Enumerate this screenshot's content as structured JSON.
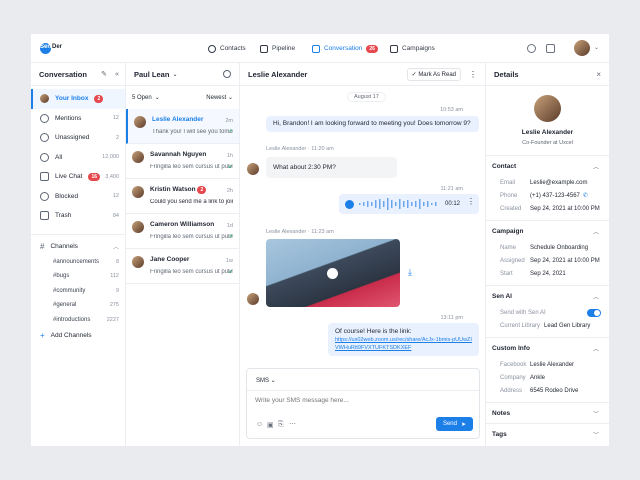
{
  "topbar": {
    "logo_text": "Sen",
    "logo_text_bold": "Der",
    "nav": [
      {
        "label": "Contacts",
        "icon": "contacts-icon"
      },
      {
        "label": "Pipeline",
        "icon": "pipeline-icon"
      },
      {
        "label": "Conversation",
        "icon": "conversation-icon",
        "badge": "26",
        "active": true
      },
      {
        "label": "Campaigns",
        "icon": "campaigns-icon"
      }
    ]
  },
  "sidebar": {
    "title": "Conversation",
    "items": [
      {
        "label": "Your Inbox",
        "badge": "2",
        "active": true
      },
      {
        "label": "Mentions",
        "count": "12"
      },
      {
        "label": "Unassigned",
        "count": "2"
      },
      {
        "label": "All",
        "count": "12,000"
      },
      {
        "label": "Live Chat",
        "badge": "16",
        "count": "3,400"
      },
      {
        "label": "Blocked",
        "count": "12"
      },
      {
        "label": "Trash",
        "count": "84"
      }
    ],
    "channels_title": "Channels",
    "channels": [
      {
        "label": "#announcements",
        "count": "8"
      },
      {
        "label": "#bugs",
        "count": "112"
      },
      {
        "label": "#community",
        "count": "9"
      },
      {
        "label": "#general",
        "count": "275"
      },
      {
        "label": "#introductions",
        "count": "2227"
      }
    ],
    "add_channels": "Add Channels"
  },
  "list": {
    "owner": "Paul Lean",
    "filter": "5 Open",
    "sort": "Newest",
    "conversations": [
      {
        "name": "Leslie Alexander",
        "time": "2m",
        "preview": "Thank you! I will see you tomorrow...",
        "active": true
      },
      {
        "name": "Savannah Nguyen",
        "time": "1h",
        "preview": "Fringilla leo sem cursus ut pulvina..."
      },
      {
        "name": "Kristin Watson",
        "badge": "2",
        "time": "2h",
        "preview": "Could you send me a link to join..."
      },
      {
        "name": "Cameron Williamson",
        "time": "1d",
        "preview": "Fringilla leo sem cursus ut pulvina..."
      },
      {
        "name": "Jane Cooper",
        "time": "1w",
        "preview": "Fringilla leo sem cursus ut pulvina..."
      }
    ]
  },
  "chat": {
    "contact": "Leslie Alexander",
    "mark_read": "Mark As Read",
    "date_divider": "August 17",
    "messages": {
      "m1_time": "10:53 am",
      "m1_text": "Hi, Brandon! I am looking forward to meeting you! Does tomorrow 9?",
      "m2_sender": "Leslie Alexander",
      "m2_time": "11:20 am",
      "m2_text": "What about 2:30 PM?",
      "m3_time": "11:21 am",
      "m3_duration": "00:12",
      "m4_sender": "Leslie Alexander",
      "m4_time": "11:23 am",
      "m5_time": "13:11 pm",
      "m5_text": "Of course! Here is the link:",
      "m5_link": "https://us02web.zoom.us/rec/share/AcJx-1bmis-pUUwZIVWHuRtt9FVXTUFKTSDKXEF"
    },
    "composer": {
      "channel": "SMS",
      "placeholder": "Write your SMS message here...",
      "send": "Send"
    }
  },
  "details": {
    "title": "Details",
    "name": "Leslie Alexander",
    "role": "Co-Founder at Uxcel",
    "contact_title": "Contact",
    "contact": [
      {
        "label": "Email",
        "value": "Leslie@example.com"
      },
      {
        "label": "Phone",
        "value": "(+1) 437-123-4567"
      },
      {
        "label": "Created",
        "value": "Sep 24, 2021 at 10:00 PM"
      }
    ],
    "campaign_title": "Campaign",
    "campaign": [
      {
        "label": "Name",
        "value": "Schedule Onboarding"
      },
      {
        "label": "Assigned",
        "value": "Sep 24, 2021 at 10:00 PM"
      },
      {
        "label": "Start",
        "value": "Sep 24, 2021"
      }
    ],
    "ai_title": "Sen AI",
    "ai_send_with": "Send with Sen AI",
    "ai_current_label": "Current Library",
    "ai_current_value": "Lead Gen Library",
    "custom_title": "Custom Info",
    "custom": [
      {
        "label": "Facebook",
        "value": "Leslie Alexander"
      },
      {
        "label": "Company",
        "value": "Ankle"
      },
      {
        "label": "Address",
        "value": "6545 Rodeo Drive"
      }
    ],
    "notes_title": "Notes",
    "tags_title": "Tags"
  }
}
